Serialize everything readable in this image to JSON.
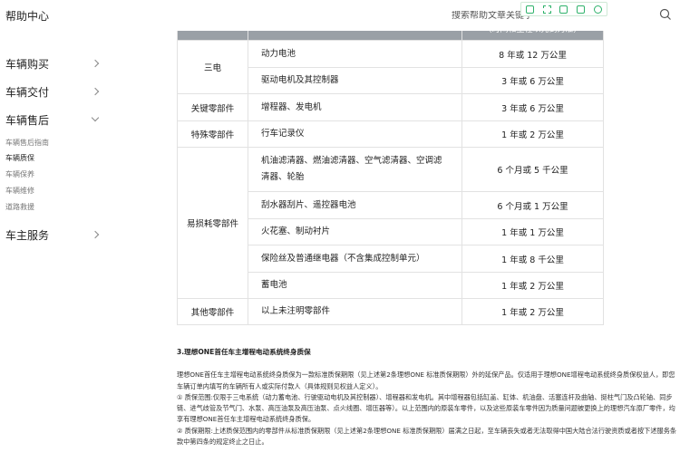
{
  "header": {
    "title": "帮助中心",
    "search_placeholder": "搜索帮助文章关键字"
  },
  "sidebar": {
    "items": [
      {
        "label": "车辆购买"
      },
      {
        "label": "车辆交付"
      },
      {
        "label": "车辆售后"
      },
      {
        "label": "车主服务"
      }
    ],
    "sub_items": [
      {
        "label": "车辆售后指南"
      },
      {
        "label": "车辆质保"
      },
      {
        "label": "车辆保养"
      },
      {
        "label": "车辆维修"
      },
      {
        "label": "道路救援"
      }
    ]
  },
  "table": {
    "header_term": "（时间和里程以先到为准）",
    "rows": [
      {
        "category": "三电",
        "part": "动力电池",
        "term": "8 年或 12 万公里"
      },
      {
        "part": "驱动电机及其控制器",
        "term": "3 年或 6 万公里"
      },
      {
        "category": "关键零部件",
        "part": "增程器、发电机",
        "term": "3 年或 6 万公里"
      },
      {
        "category": "特殊零部件",
        "part": "行车记录仪",
        "term": "1 年或 2 万公里"
      },
      {
        "category": "易损耗零部件",
        "part": "机油滤清器、燃油滤清器、空气滤清器、空调滤清器、轮胎",
        "term": "6 个月或 5 千公里"
      },
      {
        "part": "刮水器刮片、遥控器电池",
        "term": "6 个月或 1 万公里"
      },
      {
        "part": "火花塞、制动衬片",
        "term": "1 年或 1 万公里"
      },
      {
        "part": "保险丝及普通继电器（不含集成控制单元）",
        "term": "1 年或 8 千公里"
      },
      {
        "part": "蓄电池",
        "term": "1 年或 2 万公里"
      },
      {
        "category": "其他零部件",
        "part": "以上未注明零部件",
        "term": "1 年或 2 万公里"
      }
    ]
  },
  "content": {
    "title": "3.理想ONE首任车主增程电动系统终身质保",
    "p1": "理想ONE首任车主增程电动系统终身质保为一款标准质保期限（见上述第2条理想ONE 标准质保期限）外的延保产品。仅适用于理想ONE增程电动系统终身质保权益人，即您车辆订单内填写的车辆所有人或实际付款人（具体规则见权益人定义）。",
    "p2": "① 质保范围:仅限于三电系统（动力蓄电池、行驶驱动电机及其控制器）、增程器和发电机。其中增程器包括缸盖、缸体、机油盘、活塞连杆及曲轴、挺柱气门及凸轮轴、同步链、进气歧管及节气门、水泵、高压油泵及高压油泵、点火线圈、增压器等）。以上范围内的原装车零件，以及这些原装车零件因为质量问题被更换上的理想汽车原厂零件，均享有理想ONE首任车主增程电动系统终身质保。",
    "p3": "② 质保期限:上述质保范围内的零部件从标准质保期限（见上述第2条理想ONE 标准质保期限）届满之日起，至车辆丧失或者无法取得中国大陆合法行驶资质或者按下述服务条款中第四条的规定终止之日止。"
  }
}
